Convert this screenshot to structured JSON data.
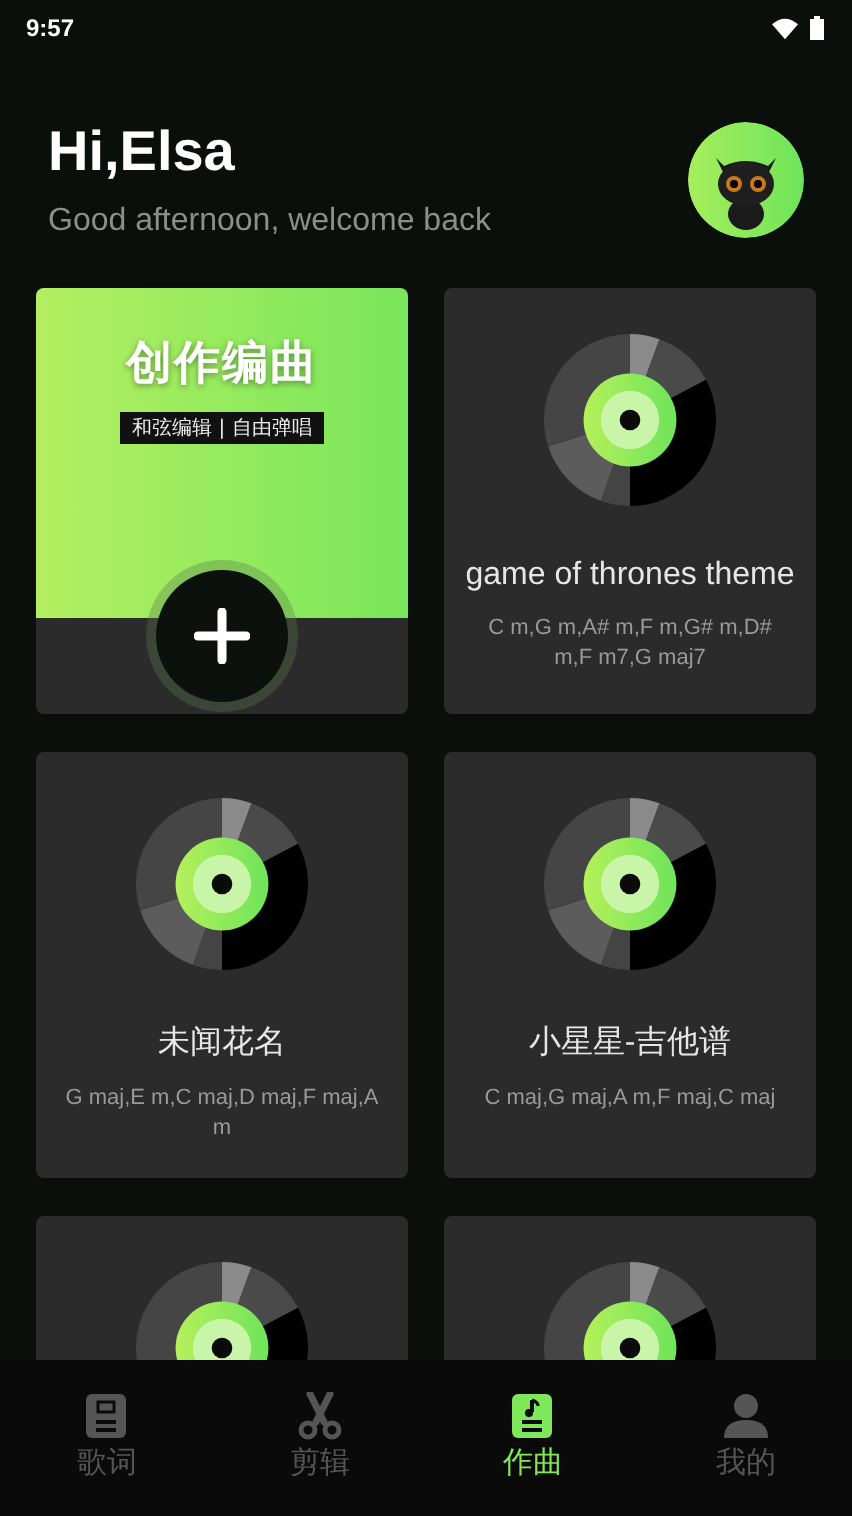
{
  "status_bar": {
    "time": "9:57"
  },
  "header": {
    "greeting": "Hi,Elsa",
    "subtitle": "Good afternoon, welcome back"
  },
  "create_card": {
    "title": "创作编曲",
    "tagline": "和弦编辑 | 自由弹唱"
  },
  "songs": [
    {
      "kind": "full",
      "title": "game of thrones theme",
      "chords": "C m,G m,A# m,F m,G# m,D# m,F m7,G maj7"
    },
    {
      "kind": "full",
      "title": "未闻花名",
      "chords": "G maj,E m,C maj,D maj,F maj,A m"
    },
    {
      "kind": "full",
      "title": "小星星-吉他谱",
      "chords": "C maj,G maj,A m,F maj,C maj"
    },
    {
      "kind": "cut"
    },
    {
      "kind": "cut"
    }
  ],
  "tabs": [
    {
      "label": "歌词",
      "kind": "lyrics",
      "selected": false
    },
    {
      "label": "剪辑",
      "kind": "edit",
      "selected": false
    },
    {
      "label": "作曲",
      "kind": "compose",
      "selected": true
    },
    {
      "label": "我的",
      "kind": "profile",
      "selected": false
    }
  ]
}
